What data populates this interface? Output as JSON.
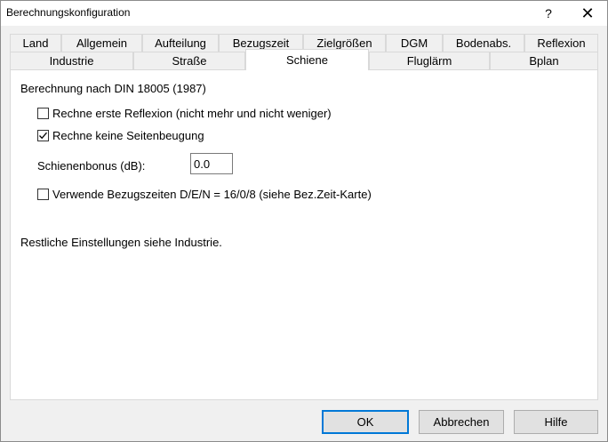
{
  "window": {
    "title": "Berechnungskonfiguration",
    "help_glyph": "?",
    "close_glyph": "✕"
  },
  "tabs_top": [
    "Land",
    "Allgemein",
    "Aufteilung",
    "Bezugszeit",
    "Zielgrößen",
    "DGM",
    "Bodenabs.",
    "Reflexion"
  ],
  "tabs_bottom": [
    "Industrie",
    "Straße",
    "Schiene",
    "Fluglärm",
    "Bplan"
  ],
  "active_tab": "Schiene",
  "panel": {
    "heading": "Berechnung nach DIN 18005 (1987)",
    "opt_reflection": {
      "label": "Rechne erste Reflexion (nicht mehr und nicht weniger)",
      "checked": false
    },
    "opt_diffraction": {
      "label": "Rechne keine Seitenbeugung",
      "checked": true
    },
    "bonus": {
      "label": "Schienenbonus (dB):",
      "value": "0.0"
    },
    "opt_refperiods": {
      "label": "Verwende Bezugszeiten D/E/N = 16/0/8 (siehe Bez.Zeit-Karte)",
      "checked": false
    },
    "note": "Restliche Einstellungen siehe Industrie."
  },
  "buttons": {
    "ok": "OK",
    "cancel": "Abbrechen",
    "help": "Hilfe"
  },
  "colors": {
    "accent": "#0078d7",
    "check_mark": "#000000"
  }
}
